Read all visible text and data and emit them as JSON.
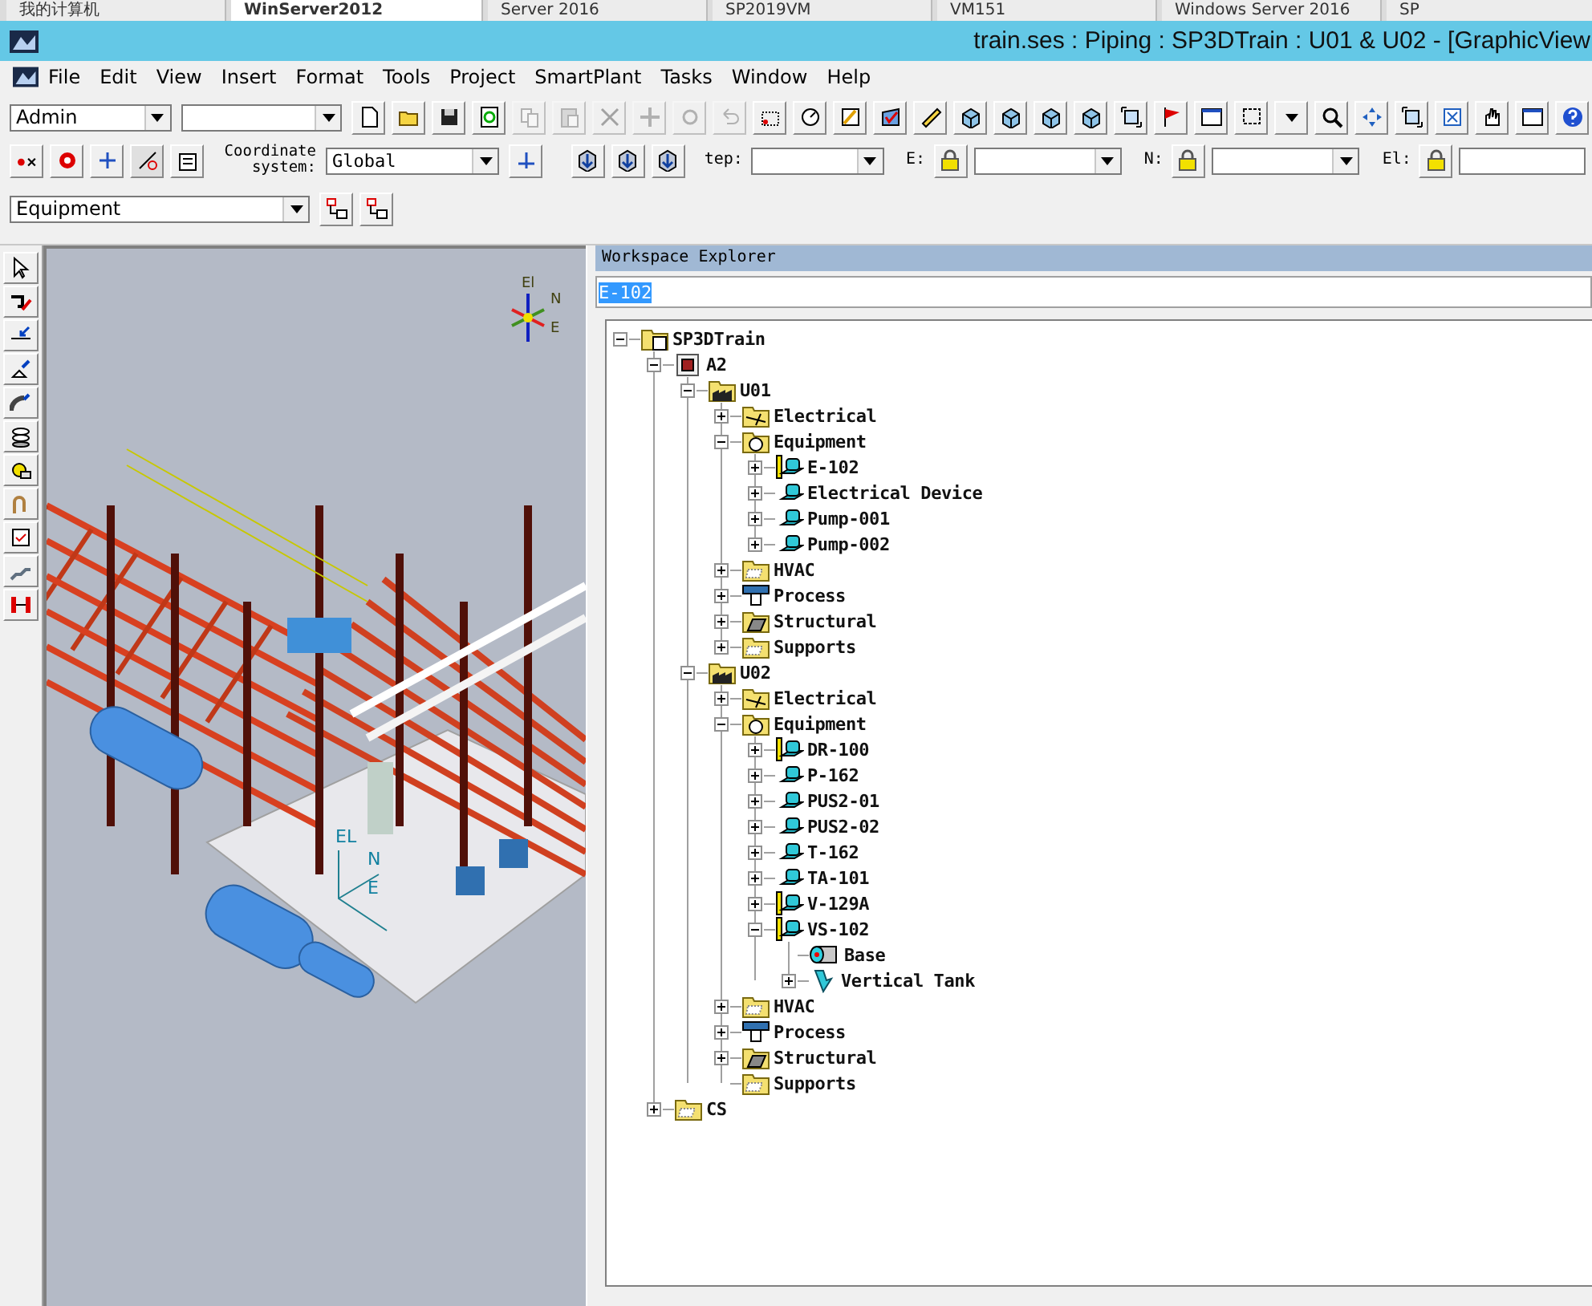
{
  "browser_tabs": [
    {
      "label": "我的计算机",
      "selected": false
    },
    {
      "label": "WinServer2012",
      "selected": true
    },
    {
      "label": "Server 2016",
      "selected": false
    },
    {
      "label": "SP2019VM",
      "selected": false
    },
    {
      "label": "VM151",
      "selected": false
    },
    {
      "label": "Windows Server 2016",
      "selected": false
    },
    {
      "label": "SP",
      "selected": false
    }
  ],
  "window": {
    "title": "train.ses : Piping : SP3DTrain : U01 & U02 - [GraphicView"
  },
  "menu": [
    "File",
    "Edit",
    "View",
    "Insert",
    "Format",
    "Tools",
    "Project",
    "SmartPlant",
    "Tasks",
    "Window",
    "Help"
  ],
  "toolbar_1": {
    "permission_group": "Admin",
    "buttons": [
      {
        "kind": "new",
        "disabled": false
      },
      {
        "kind": "open",
        "disabled": false
      },
      {
        "kind": "save",
        "disabled": false
      },
      {
        "kind": "refresh",
        "disabled": false
      },
      {
        "kind": "copy",
        "disabled": true
      },
      {
        "kind": "paste",
        "disabled": true
      },
      {
        "kind": "delete",
        "disabled": true
      },
      {
        "kind": "move",
        "disabled": true
      },
      {
        "kind": "rotate",
        "disabled": true
      },
      {
        "kind": "undo",
        "disabled": true
      },
      {
        "kind": "point",
        "disabled": false
      },
      {
        "kind": "dial",
        "disabled": false
      },
      {
        "kind": "pencil",
        "disabled": false
      },
      {
        "kind": "check",
        "disabled": false
      },
      {
        "kind": "ruler",
        "disabled": false
      },
      {
        "kind": "cube",
        "disabled": false
      },
      {
        "kind": "cube",
        "disabled": false
      },
      {
        "kind": "cube",
        "disabled": false
      },
      {
        "kind": "cube",
        "disabled": false
      },
      {
        "kind": "frame",
        "disabled": false
      },
      {
        "kind": "flag",
        "disabled": false
      },
      {
        "kind": "window",
        "disabled": false
      },
      {
        "kind": "select",
        "disabled": false
      },
      {
        "kind": "caret",
        "disabled": false
      },
      {
        "kind": "search",
        "disabled": false
      },
      {
        "kind": "pan",
        "disabled": false
      },
      {
        "kind": "frame",
        "disabled": false
      },
      {
        "kind": "fit",
        "disabled": false
      },
      {
        "kind": "hand",
        "disabled": false
      },
      {
        "kind": "window",
        "disabled": false
      },
      {
        "kind": "help",
        "disabled": false
      }
    ]
  },
  "toolbar_2": {
    "coordinate_label": "Coordinate system:",
    "coordinate_system": "Global",
    "step_label": "tep:",
    "e_label": "E:",
    "n_label": "N:",
    "el_label": "El:"
  },
  "toolbar_3": {
    "locate_filter": "Equipment"
  },
  "viewport": {
    "compass_labels": [
      "El",
      "N",
      "E"
    ],
    "axis_labels": [
      "EL",
      "N",
      "E"
    ]
  },
  "workspace_explorer": {
    "title": "Workspace Explorer",
    "search_value": "E-102",
    "tree": [
      {
        "label": "SP3DTrain",
        "kind": "project",
        "expanded": true,
        "children": [
          {
            "label": "A2",
            "kind": "area",
            "expanded": true,
            "children": [
              {
                "label": "U01",
                "kind": "unit",
                "expanded": true,
                "children": [
                  {
                    "label": "Electrical",
                    "kind": "electrical",
                    "expanded": false
                  },
                  {
                    "label": "Equipment",
                    "kind": "equipment-folder",
                    "expanded": true,
                    "children": [
                      {
                        "label": "E-102",
                        "kind": "equipment-marked",
                        "expanded": false
                      },
                      {
                        "label": "Electrical Device",
                        "kind": "equipment",
                        "expanded": false
                      },
                      {
                        "label": "Pump-001",
                        "kind": "equipment",
                        "expanded": false
                      },
                      {
                        "label": "Pump-002",
                        "kind": "equipment",
                        "expanded": false
                      }
                    ]
                  },
                  {
                    "label": "HVAC",
                    "kind": "folder",
                    "expanded": false
                  },
                  {
                    "label": "Process",
                    "kind": "process",
                    "expanded": false
                  },
                  {
                    "label": "Structural",
                    "kind": "structural",
                    "expanded": false
                  },
                  {
                    "label": "Supports",
                    "kind": "folder",
                    "expanded": false
                  }
                ]
              },
              {
                "label": "U02",
                "kind": "unit",
                "expanded": true,
                "children": [
                  {
                    "label": "Electrical",
                    "kind": "electrical",
                    "expanded": false
                  },
                  {
                    "label": "Equipment",
                    "kind": "equipment-folder",
                    "expanded": true,
                    "children": [
                      {
                        "label": "DR-100",
                        "kind": "equipment-marked",
                        "expanded": false
                      },
                      {
                        "label": "P-162",
                        "kind": "equipment",
                        "expanded": false
                      },
                      {
                        "label": "PUS2-01",
                        "kind": "equipment",
                        "expanded": false
                      },
                      {
                        "label": "PUS2-02",
                        "kind": "equipment",
                        "expanded": false
                      },
                      {
                        "label": "T-162",
                        "kind": "equipment",
                        "expanded": false
                      },
                      {
                        "label": "TA-101",
                        "kind": "equipment",
                        "expanded": false
                      },
                      {
                        "label": "V-129A",
                        "kind": "equipment-marked",
                        "expanded": false
                      },
                      {
                        "label": "VS-102",
                        "kind": "equipment-marked",
                        "expanded": true,
                        "children": [
                          {
                            "label": "Base",
                            "kind": "shape"
                          },
                          {
                            "label": "Vertical Tank",
                            "kind": "tank",
                            "expanded": false
                          }
                        ]
                      }
                    ]
                  },
                  {
                    "label": "HVAC",
                    "kind": "folder",
                    "expanded": false
                  },
                  {
                    "label": "Process",
                    "kind": "process",
                    "expanded": false
                  },
                  {
                    "label": "Structural",
                    "kind": "structural",
                    "expanded": false
                  },
                  {
                    "label": "Supports",
                    "kind": "folder"
                  }
                ]
              }
            ]
          },
          {
            "label": "CS",
            "kind": "folder",
            "expanded": false
          }
        ]
      }
    ]
  }
}
